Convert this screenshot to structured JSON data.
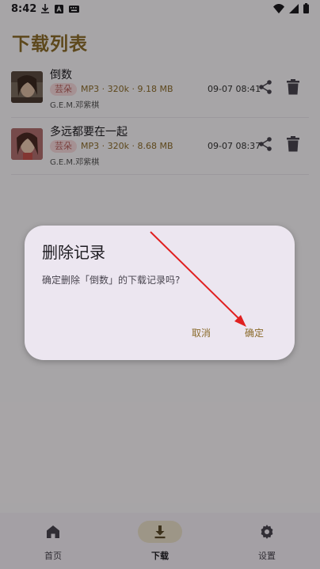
{
  "status_bar": {
    "time": "8:42"
  },
  "page": {
    "title": "下载列表"
  },
  "tracks": [
    {
      "title": "倒数",
      "source": "芸朵",
      "meta": "MP3 · 320k · 9.18 MB",
      "artist": "G.E.M.邓紫棋",
      "date": "09-07 08:41"
    },
    {
      "title": "多远都要在一起",
      "source": "芸朵",
      "meta": "MP3 · 320k · 8.68 MB",
      "artist": "G.E.M.邓紫棋",
      "date": "09-07 08:37"
    }
  ],
  "dialog": {
    "title": "删除记录",
    "message": "确定删除「倒数」的下载记录吗?",
    "cancel_label": "取消",
    "confirm_label": "确定"
  },
  "bottom_nav": {
    "items": [
      {
        "label": "首页",
        "icon": "home-icon"
      },
      {
        "label": "下载",
        "icon": "download-icon",
        "selected": true
      },
      {
        "label": "设置",
        "icon": "gear-icon"
      }
    ]
  },
  "colors": {
    "accent": "#8a6a2a",
    "badge_bg": "#f3d6d9",
    "badge_text": "#b5615e",
    "dialog_bg": "#ece6f0",
    "annotation_arrow": "#e02020"
  }
}
